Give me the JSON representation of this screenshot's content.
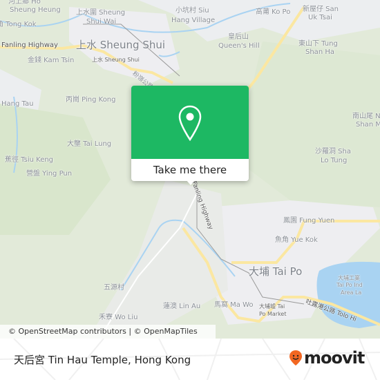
{
  "map": {
    "labels": [
      "河上鄉 Ho",
      "Sheung Heung",
      "上水圍 Sheung",
      "Shui Wai",
      "小坑村 Siu",
      "Hang Village",
      "高莆 Ko Po",
      "新屋仔 San",
      "Uk Tsai",
      "角 Tong Kok",
      "Fanling Highway",
      "上水 Sheung Shui",
      "皇后山",
      "Queen's Hill",
      "東山下 Tung",
      "Shan Ha",
      "金錢 Kam Tsin",
      "上水 Sheung Shui",
      "粉嶺公路",
      "丙崗 Ping Kong",
      "Hang Tau",
      "南山尾 Nam",
      "Shan Mei",
      "大壟 Tai Lung",
      "沙羅洞 Sha",
      "Lo Tung",
      "蕉徑 Tsiu Keng",
      "營盤 Ying Pun",
      "Fanling Highway",
      "鳳園 Fung Yuen",
      "魚角 Yue Kok",
      "大埔 Tai Po",
      "大埔工業",
      "Tai Po Ind",
      "Area La",
      "五源村",
      "蓮澳 Lin Au",
      "馬窩 Ma Wo",
      "大埔墟 Tai",
      "Po Market",
      "吐露港公路 Tolo Hi",
      "禾寮 Wo Liu"
    ],
    "attribution": "© OpenStreetMap contributors | © OpenMapTiles",
    "colors": {
      "land": "#e6ecdf",
      "water": "#a9d3f2",
      "road": "#fbe7a1",
      "urban": "#f0f0f2"
    }
  },
  "popup": {
    "button_label": "Take me there",
    "color": "#1db863"
  },
  "footer": {
    "title": "天后宮 Tin Hau Temple, Hong Kong",
    "logo_text": "moovit",
    "logo_color": "#f26722"
  }
}
